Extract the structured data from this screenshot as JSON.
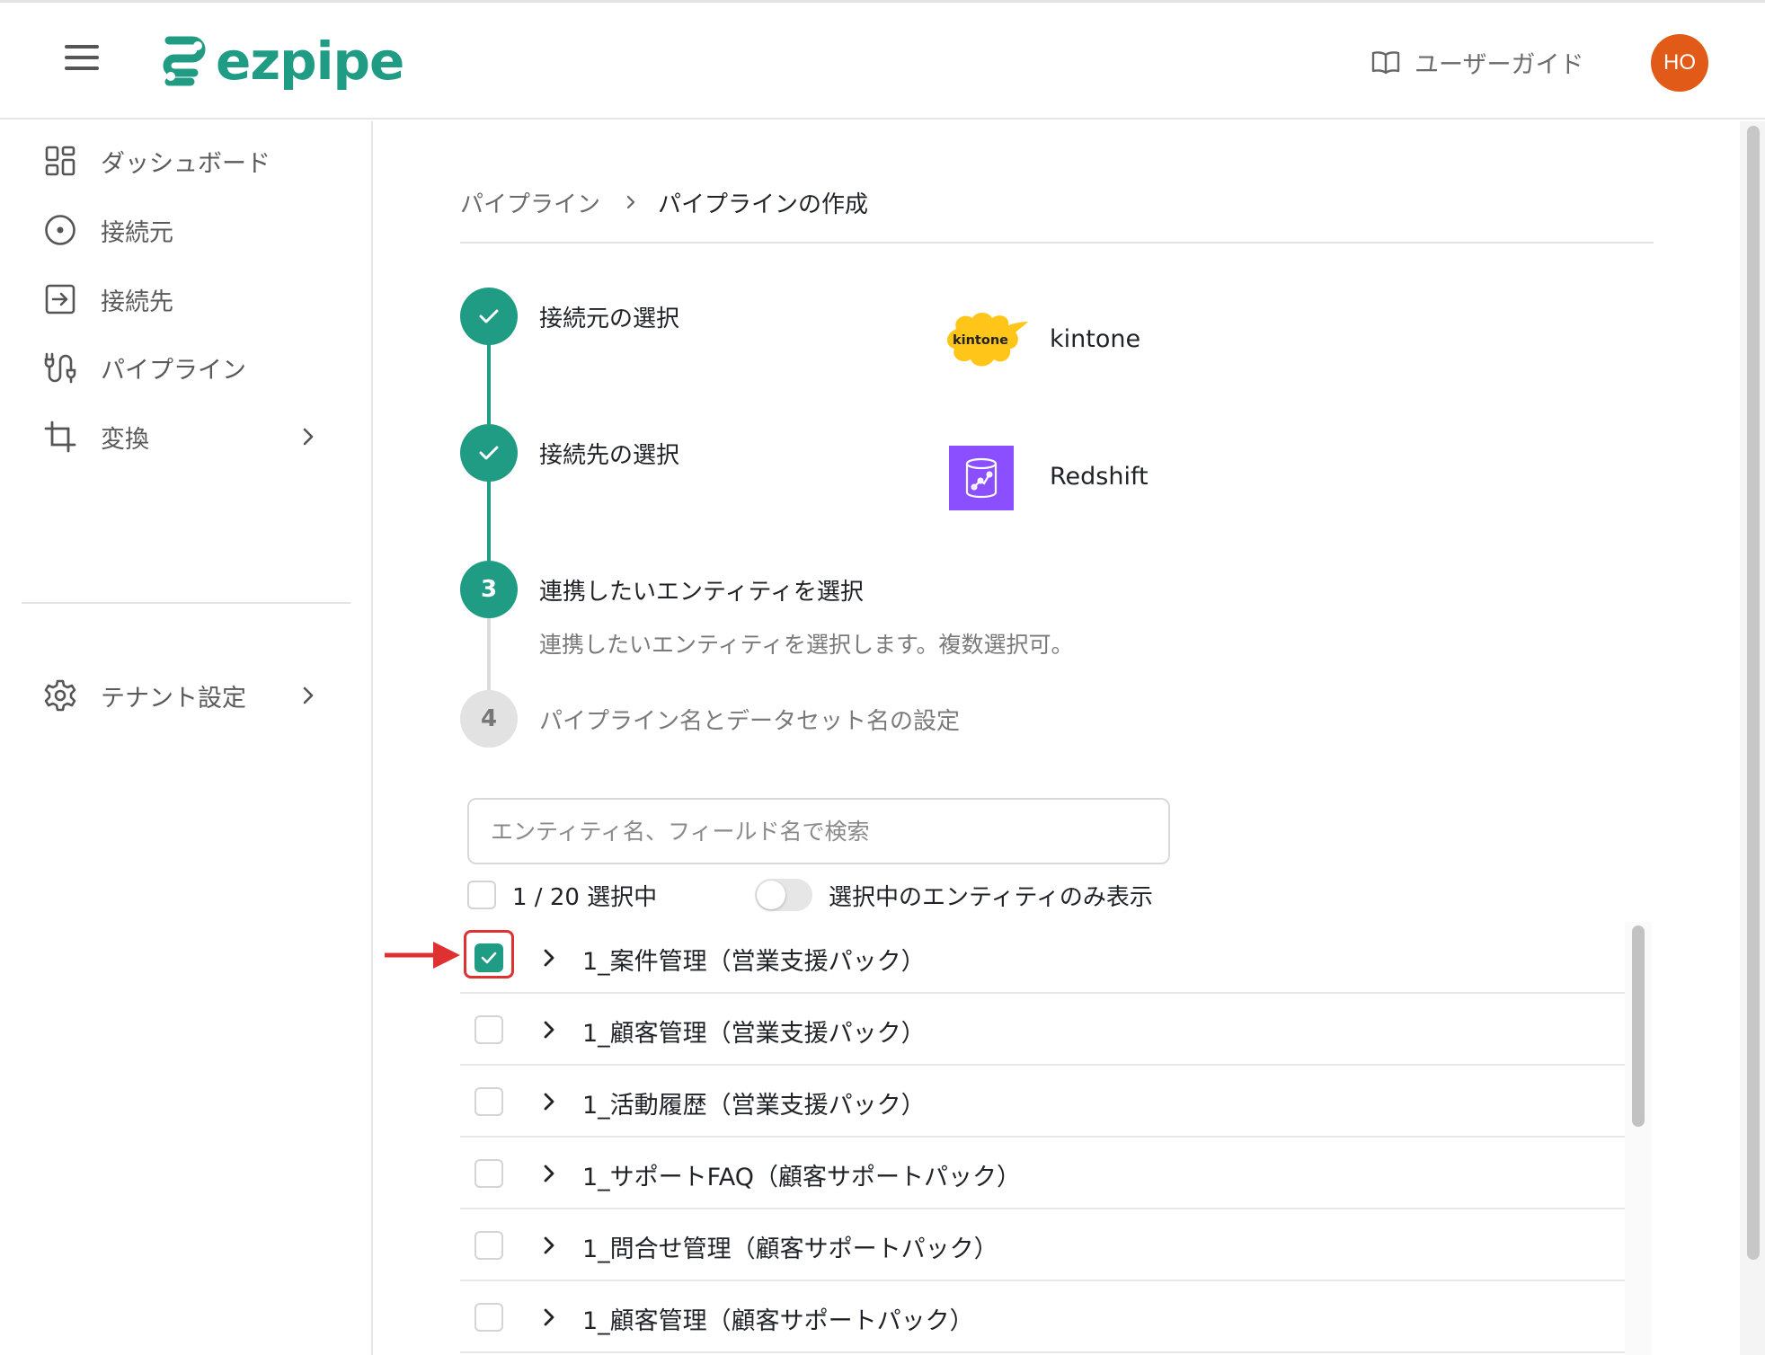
{
  "header": {
    "logo_text": "ezpipe",
    "guide_label": "ユーザーガイド",
    "avatar_initials": "HO",
    "brand_color": "#1f9c83",
    "avatar_color": "#e15a17"
  },
  "sidebar": {
    "items": [
      {
        "label": "ダッシュボード",
        "icon": "dashboard-icon"
      },
      {
        "label": "接続元",
        "icon": "source-icon"
      },
      {
        "label": "接続先",
        "icon": "destination-icon"
      },
      {
        "label": "パイプライン",
        "icon": "pipeline-icon"
      },
      {
        "label": "変換",
        "icon": "crop-icon",
        "has_submenu": true
      }
    ],
    "settings": {
      "label": "テナント設定",
      "icon": "gear-icon",
      "has_submenu": true
    }
  },
  "breadcrumb": {
    "parent": "パイプライン",
    "current": "パイプラインの作成"
  },
  "steps": [
    {
      "number": "1",
      "title": "接続元の選択",
      "status": "done",
      "selection": "kintone",
      "logo_text": "kintone"
    },
    {
      "number": "2",
      "title": "接続先の選択",
      "status": "done",
      "selection": "Redshift"
    },
    {
      "number": "3",
      "title": "連携したいエンティティを選択",
      "status": "active",
      "description": "連携したいエンティティを選択します。複数選択可。"
    },
    {
      "number": "4",
      "title": "パイプライン名とデータセット名の設定",
      "status": "pending"
    }
  ],
  "entity_picker": {
    "search_placeholder": "エンティティ名、フィールド名で検索",
    "selection_count": "1 / 20 選択中",
    "toggle_label": "選択中のエンティティのみ表示",
    "toggle_on": false,
    "entities": [
      {
        "name": "1_案件管理（営業支援パック）",
        "checked": true
      },
      {
        "name": "1_顧客管理（営業支援パック）",
        "checked": false
      },
      {
        "name": "1_活動履歴（営業支援パック）",
        "checked": false
      },
      {
        "name": "1_サポートFAQ（顧客サポートパック）",
        "checked": false
      },
      {
        "name": "1_問合せ管理（顧客サポートパック）",
        "checked": false
      },
      {
        "name": "1_顧客管理（顧客サポートパック）",
        "checked": false
      }
    ]
  },
  "annotation": {
    "highlight_color": "#e03131"
  }
}
